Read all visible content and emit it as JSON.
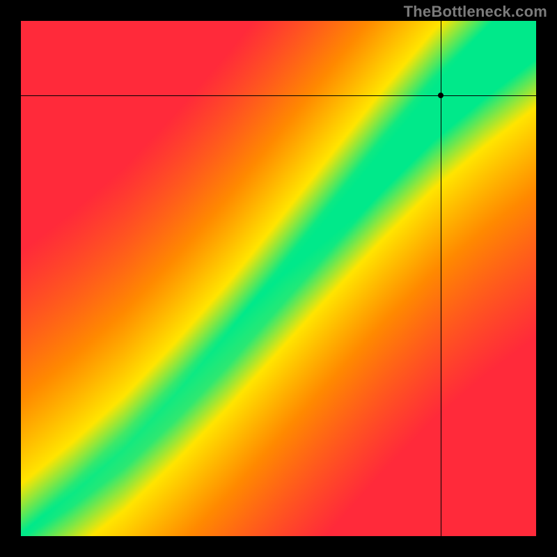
{
  "watermark": "TheBottleneck.com",
  "chart_data": {
    "type": "heatmap",
    "title": "",
    "xlabel": "",
    "ylabel": "",
    "xlim": [
      0,
      1
    ],
    "ylim": [
      0,
      1
    ],
    "crosshair": {
      "x": 0.815,
      "y": 0.856
    },
    "point": {
      "x": 0.815,
      "y": 0.856
    },
    "colors": {
      "low": "#ff2a3a",
      "mid1": "#ff8a00",
      "mid2": "#ffe500",
      "high": "#00e98a"
    },
    "ridge": {
      "description": "Optimal diagonal band where components are balanced",
      "curve": [
        {
          "x": 0.0,
          "y": 0.0
        },
        {
          "x": 0.1,
          "y": 0.07
        },
        {
          "x": 0.2,
          "y": 0.15
        },
        {
          "x": 0.3,
          "y": 0.25
        },
        {
          "x": 0.4,
          "y": 0.36
        },
        {
          "x": 0.5,
          "y": 0.48
        },
        {
          "x": 0.6,
          "y": 0.6
        },
        {
          "x": 0.7,
          "y": 0.72
        },
        {
          "x": 0.8,
          "y": 0.83
        },
        {
          "x": 0.9,
          "y": 0.92
        },
        {
          "x": 1.0,
          "y": 1.0
        }
      ],
      "width_start": 0.01,
      "width_end": 0.14
    }
  }
}
